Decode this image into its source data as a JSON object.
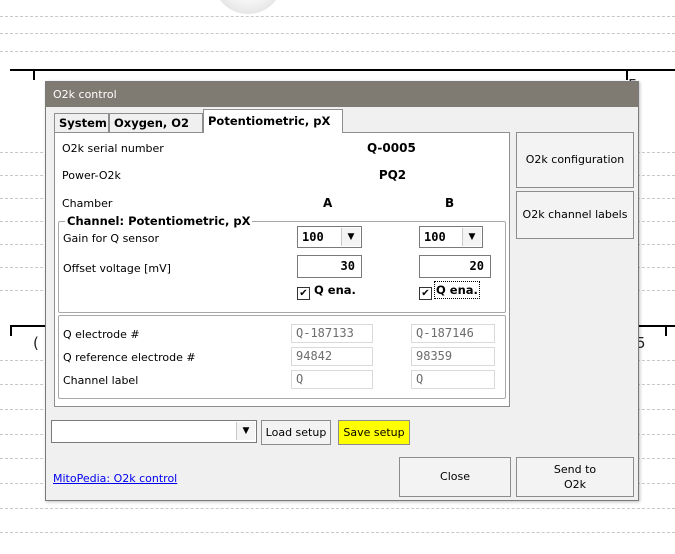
{
  "window": {
    "title": "O2k control"
  },
  "tabs": [
    {
      "label": "System"
    },
    {
      "label": "Oxygen, O2"
    },
    {
      "label": "Potentiometric, pX"
    }
  ],
  "info": {
    "serial_label": "O2k serial number",
    "serial_value": "Q-0005",
    "power_label": "Power-O2k",
    "power_value": "PQ2",
    "chamber_label": "Chamber",
    "chamber_a": "A",
    "chamber_b": "B"
  },
  "channel": {
    "title": "Channel: Potentiometric, pX",
    "gain_label": "Gain for Q sensor",
    "gain_a": "100",
    "gain_b": "100",
    "offset_label": "Offset voltage [mV]",
    "offset_a": "30",
    "offset_b": "20",
    "enable_a": {
      "checked": true,
      "label": "Q ena."
    },
    "enable_b": {
      "checked": true,
      "label": "Q ena."
    }
  },
  "electrodes": {
    "electrode_label": "Q electrode #",
    "electrode_a": "Q-187133",
    "electrode_b": "Q-187146",
    "reference_label": "Q reference electrode #",
    "reference_a": "94842",
    "reference_b": "98359",
    "channel_label_label": "Channel label",
    "channel_label_a": "Q",
    "channel_label_b": "Q"
  },
  "side_buttons": {
    "configuration": "O2k configuration",
    "channel_labels": "O2k channel labels"
  },
  "setup": {
    "selected": "",
    "load_label": "Load setup",
    "save_label": "Save setup"
  },
  "footer": {
    "link": "MitoPedia: O2k control",
    "close_label": "Close",
    "send_label_line1": "Send to",
    "send_label_line2": "O2k"
  },
  "colors": {
    "titlebar": "#7f7a72",
    "save_button": "#ffff00",
    "link": "#0000ee"
  },
  "background": {
    "axis_glyph_left": "(",
    "axis_glyph_right": "5"
  }
}
